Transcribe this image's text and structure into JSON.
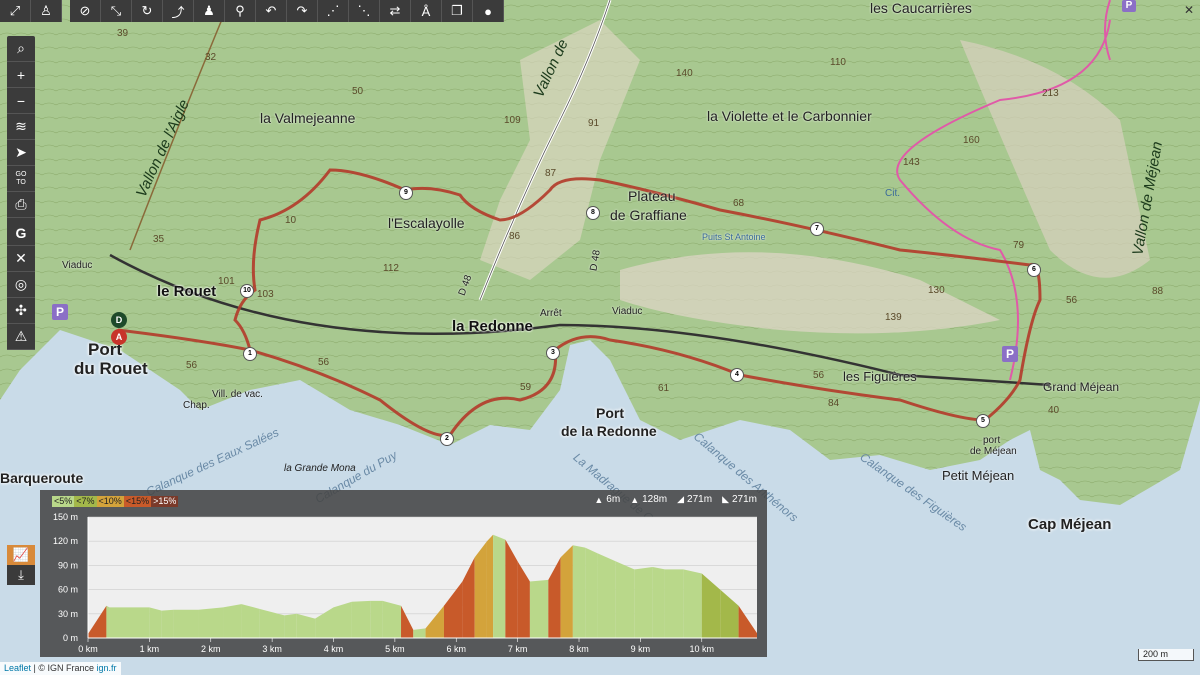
{
  "toolbar": {
    "left_icons": [
      "expand-icon",
      "pegman-icon"
    ],
    "tools": [
      "visibility-off-icon",
      "route-icon",
      "route-loop-icon",
      "route-free-icon",
      "walk-icon",
      "bike-icon",
      "undo-icon",
      "redo-icon",
      "route-alt-icon",
      "route-steps-icon",
      "reverse-icon",
      "translate-icon",
      "copy-icon",
      "pin-icon"
    ]
  },
  "leftbar": {
    "buttons": [
      "search-icon",
      "zoom-in-icon",
      "zoom-out-icon",
      "layers-icon",
      "locate-icon",
      "go-to-icon",
      "print-icon",
      "help-icon"
    ],
    "go_to_label": "GO\nTO",
    "plus": "+",
    "minus": "−",
    "question": "?"
  },
  "map": {
    "places": {
      "le_rouet": "le Rouet",
      "port_du_rouet_1": "Port",
      "port_du_rouet_2": "du Rouet",
      "la_redonne": "la Redonne",
      "port_redonne_1": "Port",
      "port_redonne_2": "de la Redonne",
      "grand_mejean": "Grand Méjean",
      "petit_mejean": "Petit Méjean",
      "port_mejean_1": "port",
      "port_mejean_2": "de Méjean",
      "cap_mejean": "Cap Méjean",
      "les_figuieres": "les Figuières",
      "escalayolle": "l'Escalayolle",
      "valmejeanne": "la Valmejeanne",
      "violette": "la Violette et le Carbonnier",
      "caucarrieres": "les Caucarrières",
      "plateau_1": "Plateau",
      "plateau_2": "de Graffiane",
      "barqueroute": "Barqueroute",
      "grande_mona": "la Grande Mona",
      "viaduc_1": "Viaduc",
      "viaduc_2": "Viaduc",
      "arret": "Arrêt",
      "chap": "Chap.",
      "vill": "Vill. de vac.",
      "d48": "D 48",
      "d48b": "D 48",
      "puits": "Puits St Antoine"
    },
    "sea_labels": {
      "eaux_salees": "Calanque des Eaux Salées",
      "du_puy": "Calanque du Puy",
      "madrague": "La Madrague de Gignac",
      "anthenors": "Calanque des Anthénors",
      "figuieres": "Calanque des Figuières"
    },
    "valleys": {
      "aigle": "Vallon de l'Aigle",
      "vallon_de": "Vallon de",
      "mejean": "Vallon de Méjean"
    },
    "altitudes": [
      "39",
      "32",
      "50",
      "109",
      "140",
      "110",
      "213",
      "160",
      "143",
      "35",
      "101",
      "103",
      "10",
      "112",
      "86",
      "87",
      "91",
      "68",
      "79",
      "56",
      "88",
      "130",
      "139",
      "56",
      "84",
      "40",
      "56",
      "61",
      "59",
      "56",
      "Cit."
    ],
    "waypoints": [
      "1",
      "2",
      "3",
      "4",
      "5",
      "6",
      "7",
      "8",
      "9",
      "10"
    ],
    "start_marker": "D",
    "end_marker": "A",
    "parking": "P"
  },
  "profile": {
    "slope_legend": [
      "<5%",
      "<7%",
      "<10%",
      "<15%",
      ">15%"
    ],
    "slope_colors": [
      "#b9d88a",
      "#a3b84a",
      "#d3a33b",
      "#c85a2a",
      "#7a3a2a"
    ],
    "stats": [
      {
        "icon": "min-elevation-icon",
        "value": "6m"
      },
      {
        "icon": "max-elevation-icon",
        "value": "128m"
      },
      {
        "icon": "ascent-icon",
        "value": "271m"
      },
      {
        "icon": "descent-icon",
        "value": "271m"
      }
    ],
    "y_labels": [
      "150 m",
      "120 m",
      "90 m",
      "60 m",
      "30 m",
      "0 m"
    ],
    "x_labels": [
      "0 km",
      "1 km",
      "2 km",
      "3 km",
      "4 km",
      "5 km",
      "6 km",
      "7 km",
      "8 km",
      "9 km",
      "10 km"
    ]
  },
  "chart_data": {
    "type": "area",
    "title": "",
    "xlabel": "",
    "ylabel": "",
    "xlim": [
      0,
      10.9
    ],
    "ylim": [
      0,
      150
    ],
    "x": [
      0,
      0.3,
      0.35,
      1.0,
      1.2,
      1.4,
      1.8,
      2.2,
      2.5,
      2.8,
      3.2,
      3.4,
      3.7,
      4.0,
      4.3,
      4.6,
      4.8,
      5.1,
      5.3,
      5.5,
      5.8,
      6.1,
      6.3,
      6.5,
      6.6,
      6.8,
      7.0,
      7.2,
      7.5,
      7.7,
      7.9,
      8.1,
      8.3,
      8.6,
      8.9,
      9.2,
      9.4,
      9.7,
      10.0,
      10.3,
      10.6,
      10.9
    ],
    "series": [
      {
        "values": [
          5,
          40,
          38,
          38,
          34,
          35,
          35,
          38,
          42,
          36,
          28,
          30,
          24,
          38,
          45,
          46,
          46,
          40,
          10,
          12,
          40,
          70,
          100,
          120,
          128,
          122,
          95,
          70,
          72,
          100,
          115,
          112,
          105,
          95,
          85,
          88,
          85,
          85,
          80,
          60,
          40,
          6
        ]
      }
    ]
  },
  "scale": "200 m",
  "attribution": {
    "leaflet": "Leaflet",
    "sep": " | © IGN France ",
    "ign": "ign.fr"
  }
}
